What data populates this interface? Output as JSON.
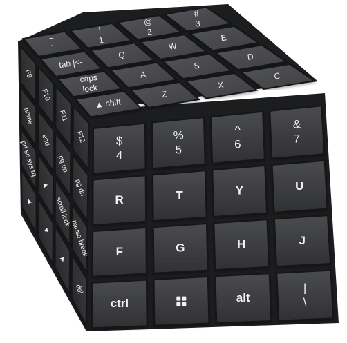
{
  "image": {
    "subject": "keyboard-key-cube",
    "background_color": "#ffffff",
    "key_color": "#3a3b3d",
    "legend_color": "#f2f2f2"
  },
  "front_face": {
    "rows": [
      [
        {
          "top": "$",
          "bottom": "4"
        },
        {
          "top": "%",
          "bottom": "5"
        },
        {
          "top": "^",
          "bottom": "6"
        },
        {
          "top": "&",
          "bottom": "7"
        }
      ],
      [
        {
          "label": "R"
        },
        {
          "label": "T"
        },
        {
          "label": "Y"
        },
        {
          "label": "U"
        }
      ],
      [
        {
          "label": "F"
        },
        {
          "label": "G"
        },
        {
          "label": "H"
        },
        {
          "label": "J"
        }
      ],
      [
        {
          "label": "ctrl"
        },
        {
          "icon": "windows-logo-icon"
        },
        {
          "label": "alt"
        },
        {
          "top": "|",
          "bottom": "\\"
        }
      ]
    ]
  },
  "top_face": {
    "rows": [
      [
        {
          "top": "~",
          "bottom": "`"
        },
        {
          "top": "!",
          "bottom": "1"
        },
        {
          "top": "@",
          "bottom": "2"
        },
        {
          "top": "#",
          "bottom": "3"
        }
      ],
      [
        {
          "label": "tab |<-"
        },
        {
          "label": "Q"
        },
        {
          "label": "W"
        },
        {
          "label": "E"
        }
      ],
      [
        {
          "top": "caps",
          "bottom": "lock"
        },
        {
          "label": "A"
        },
        {
          "label": "S"
        },
        {
          "label": "D"
        }
      ],
      [
        {
          "label": "▲ shift"
        },
        {
          "label": "Z"
        },
        {
          "label": "X"
        },
        {
          "label": "C"
        }
      ]
    ]
  },
  "left_face": {
    "rows": [
      [
        {
          "label": "F9"
        },
        {
          "label": "F10"
        },
        {
          "label": "F11"
        },
        {
          "label": "F12"
        }
      ],
      [
        {
          "label": "home"
        },
        {
          "label": "end"
        },
        {
          "label": "pg up"
        },
        {
          "label": "pg dn"
        }
      ],
      [
        {
          "label": "prt sc sys rq"
        },
        {
          "label": "▲"
        },
        {
          "label": "scroll lock"
        },
        {
          "label": "pause break"
        }
      ],
      [
        {
          "label": "◄"
        },
        {
          "label": "▼"
        },
        {
          "label": "►"
        },
        {
          "label": "del"
        }
      ]
    ]
  }
}
